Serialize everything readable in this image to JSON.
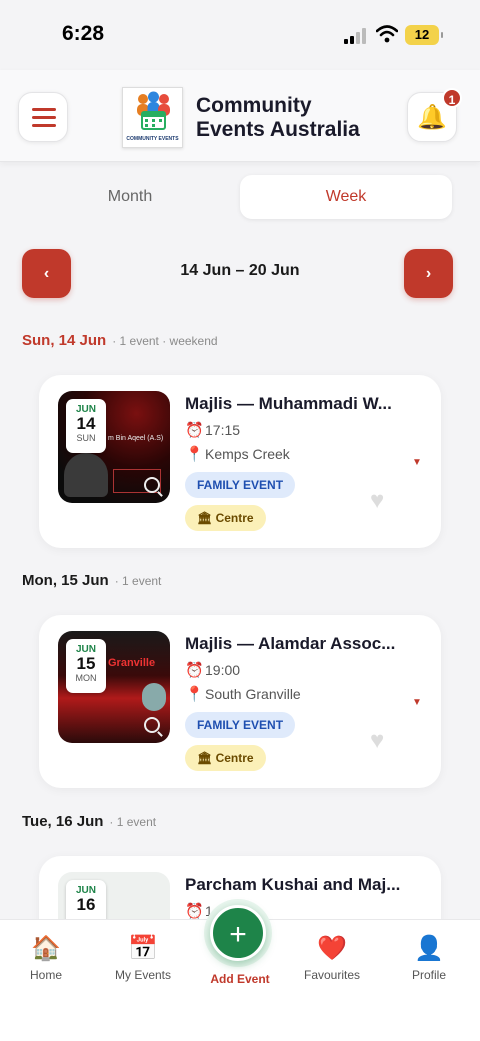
{
  "status": {
    "time": "6:28",
    "battery": "12"
  },
  "header": {
    "title_line1": "Community",
    "title_line2": "Events Australia",
    "logo_text": "COMMUNITY EVENTS",
    "notification_count": "1"
  },
  "view_toggle": {
    "month": "Month",
    "week": "Week",
    "selected": "Week"
  },
  "week_nav": {
    "range": "14 Jun – 20 Jun",
    "prev": "‹",
    "next": "›"
  },
  "days": [
    {
      "label": "Sun, 14 Jun",
      "meta": "· 1 event · weekend"
    },
    {
      "label": "Mon, 15 Jun",
      "meta": "· 1 event"
    },
    {
      "label": "Tue, 16 Jun",
      "meta": "· 1 event"
    }
  ],
  "events": [
    {
      "month": "JUN",
      "day": "14",
      "weekday": "SUN",
      "title": "Majlis — Muhammadi W...",
      "time": "17:15",
      "location": "Kemps Creek",
      "tag1": "FAMILY EVENT",
      "tag2": "Centre",
      "thumb_text": "m Bin Aqeel (A.S)"
    },
    {
      "month": "JUN",
      "day": "15",
      "weekday": "MON",
      "title": "Majlis — Alamdar Assoc...",
      "time": "19:00",
      "location": "South Granville",
      "tag1": "FAMILY EVENT",
      "tag2": "Centre",
      "thumb_text": "Granville"
    },
    {
      "month": "JUN",
      "day": "16",
      "weekday": "",
      "title": "Parcham Kushai and Maj...",
      "time": "1",
      "location": "",
      "tag1": "",
      "tag2": ""
    }
  ],
  "tabs": [
    {
      "label": "Home",
      "icon": "🏠"
    },
    {
      "label": "My Events",
      "icon": "📅"
    },
    {
      "label": "Add Event",
      "icon": "+"
    },
    {
      "label": "Favourites",
      "icon": "❤️"
    },
    {
      "label": "Profile",
      "icon": "👤"
    }
  ],
  "colors": {
    "accent": "#c0392b",
    "green": "#1e8449"
  }
}
